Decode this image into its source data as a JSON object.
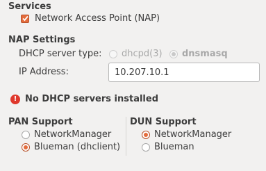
{
  "services": {
    "heading": "Services",
    "nap_label": "Network Access Point (NAP)",
    "nap_checked": true
  },
  "nap_settings": {
    "heading": "NAP Settings",
    "dhcp_label": "DHCP server type:",
    "dhcp_options": [
      {
        "label": "dhcpd(3)",
        "selected": false
      },
      {
        "label": "dnsmasq",
        "selected": true
      }
    ],
    "ip_label": "IP Address:",
    "ip_value": "10.207.10.1"
  },
  "error": {
    "icon": "error-icon",
    "icon_glyph": "!",
    "message": "No DHCP servers installed"
  },
  "pan_support": {
    "heading": "PAN Support",
    "options": [
      {
        "label": "NetworkManager",
        "selected": false
      },
      {
        "label": "Blueman (dhclient)",
        "selected": true
      }
    ]
  },
  "dun_support": {
    "heading": "DUN Support",
    "options": [
      {
        "label": "NetworkManager",
        "selected": true
      },
      {
        "label": "Blueman",
        "selected": false
      }
    ]
  },
  "colors": {
    "accent": "#e46c3c",
    "error": "#df382c",
    "background": "#f2f1f0"
  }
}
